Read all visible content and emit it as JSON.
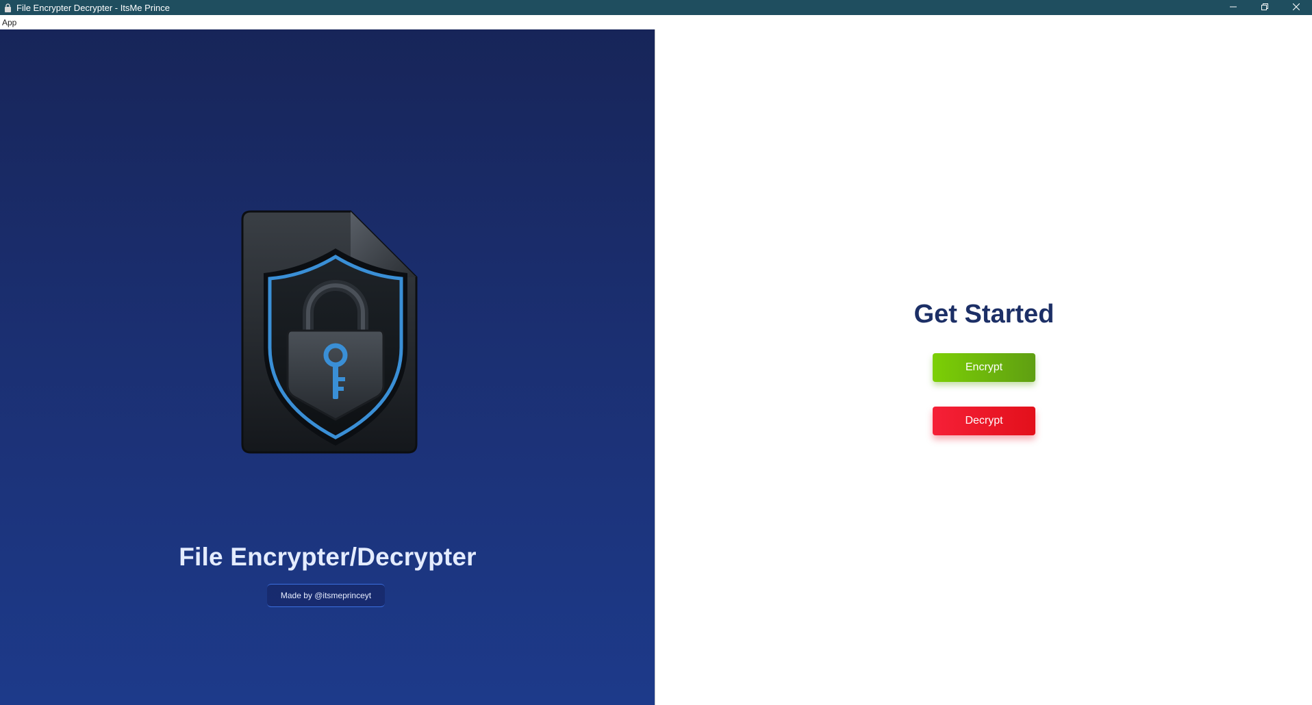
{
  "window": {
    "title": "File Encrypter Decrypter - ItsMe Prince",
    "app_icon": "lock-app-icon",
    "controls": [
      "minimize-icon",
      "restore-icon",
      "close-icon"
    ]
  },
  "menubar": {
    "items": [
      {
        "label": "App"
      }
    ]
  },
  "left_panel": {
    "hero_icon": "shield-lock-file-icon",
    "title": "File Encrypter/Decrypter",
    "credit": "Made by @itsmeprinceyt"
  },
  "right_panel": {
    "heading": "Get Started",
    "encrypt_label": "Encrypt",
    "decrypt_label": "Decrypt"
  },
  "colors": {
    "titlebar": "#1f4e5f",
    "left_panel_top": "#172559",
    "left_panel_bottom": "#1d3a8a",
    "heading": "#1c2f66",
    "encrypt": "#7ccf05",
    "decrypt": "#f52037",
    "shield_accent": "#3a8fd6"
  }
}
